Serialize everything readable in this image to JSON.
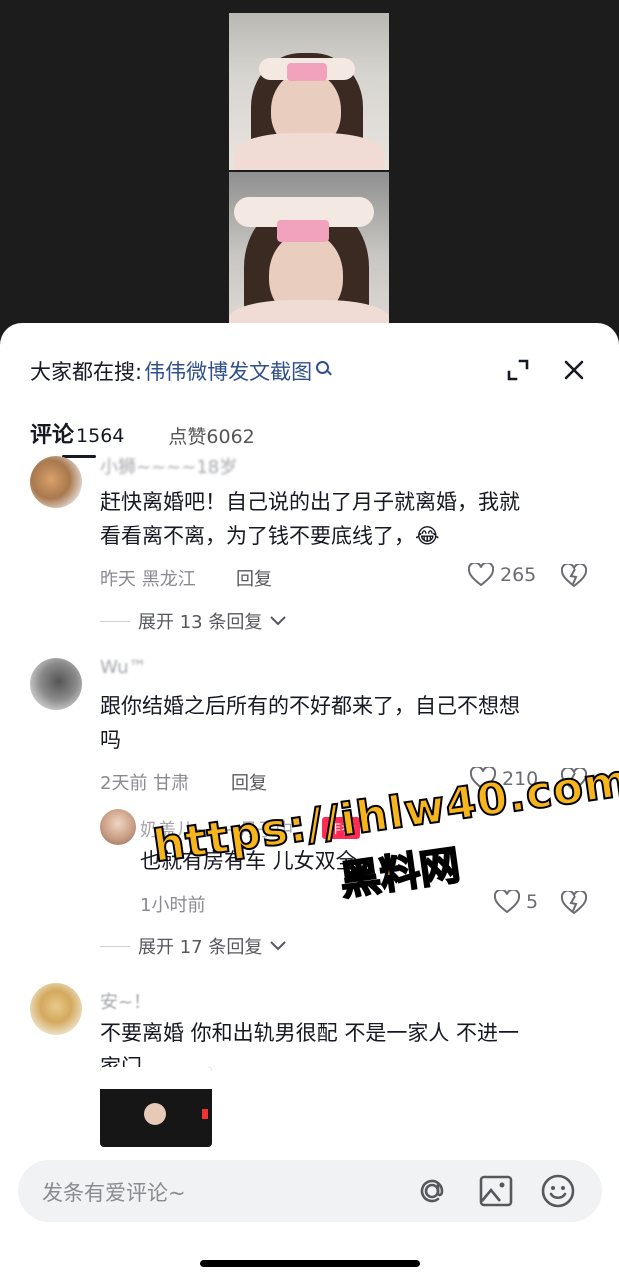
{
  "sheet": {
    "search_prefix": "大家都在搜:",
    "search_term": "伟伟微博发文截图"
  },
  "tabs": {
    "comments_label": "评论",
    "comments_count": "1564",
    "likes_label": "点赞",
    "likes_count": "6062"
  },
  "comments": [
    {
      "username": "小狮~~~~18岁",
      "text_line1": "赶快离婚吧！自己说的出了月子就离婚，我就",
      "text_line2": "看看离不离，为了钱不要底线了，😂",
      "time": "昨天",
      "location": "黑龙江",
      "reply_label": "回复",
      "likes": "265",
      "expand_label": "展开 13 条回复"
    },
    {
      "username": "Wu™",
      "text_line1": "跟你结婚之后所有的不好都来了，自己不想想",
      "text_line2": "吗",
      "time": "2天前",
      "location": "甘肃",
      "reply_label": "回复",
      "likes": "210",
      "reply": {
        "username": "奶盖儿~~~月子中",
        "badge": "作者",
        "text": "也就有房有车 儿女双全",
        "time": "1小时前",
        "likes": "5"
      },
      "expand_label": "展开 17 条回复"
    },
    {
      "username": "安~！",
      "text_line1": "不要离婚 你和出轨男很配 不是一家人 不进一",
      "text_line2": "家门"
    }
  ],
  "input": {
    "placeholder": "发条有爱评论~"
  },
  "watermark": {
    "url": "https://ihlw40.com",
    "site": "黑料网"
  }
}
